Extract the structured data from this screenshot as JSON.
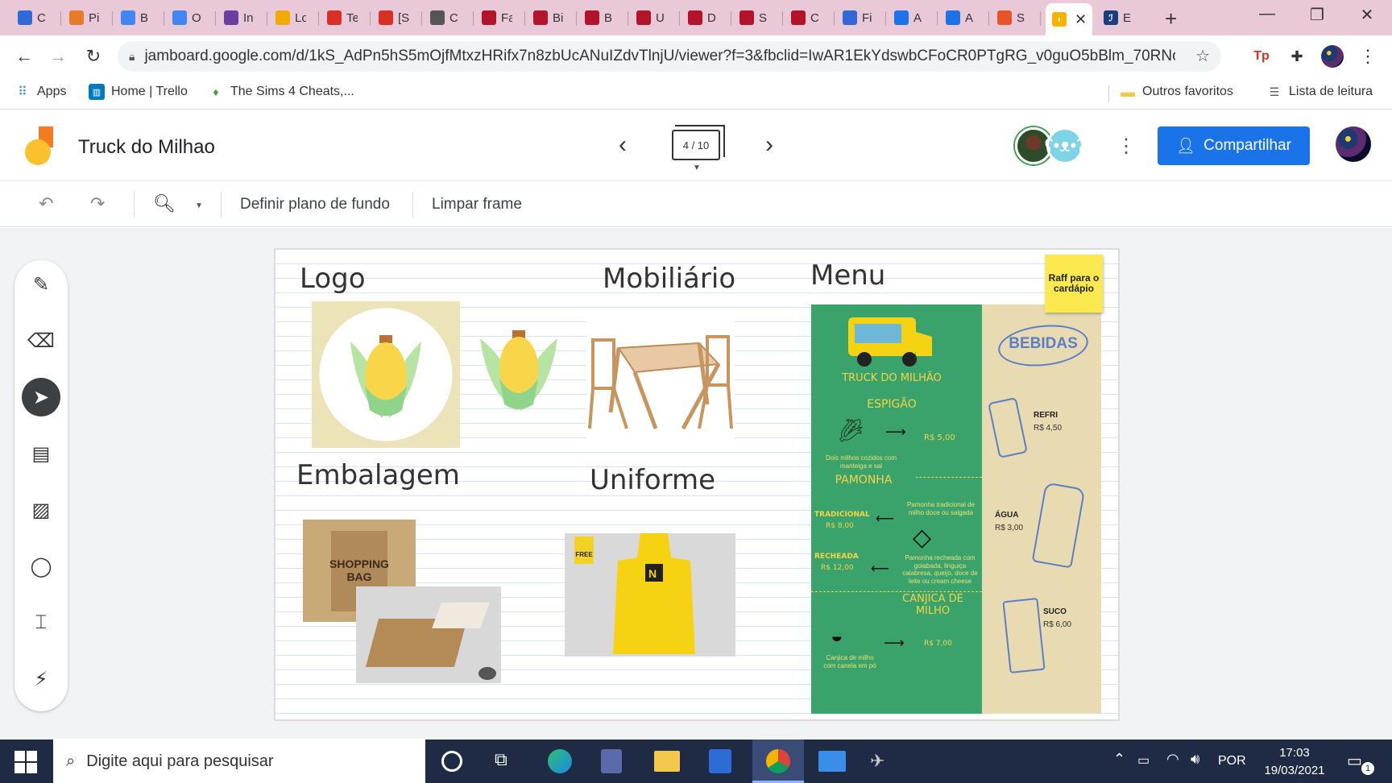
{
  "browser": {
    "tabs": [
      {
        "label": "C",
        "icon": "tab-favicon",
        "color": "#2f6bd6"
      },
      {
        "label": "Pi",
        "icon": "tab-favicon",
        "color": "#e57c2b"
      },
      {
        "label": "B",
        "icon": "google-icon",
        "color": "#4285f4"
      },
      {
        "label": "O",
        "icon": "google-icon",
        "color": "#4285f4"
      },
      {
        "label": "In",
        "icon": "tab-favicon",
        "color": "#6b3fa0"
      },
      {
        "label": "Lo",
        "icon": "tab-favicon",
        "color": "#f2a900"
      },
      {
        "label": "Te",
        "icon": "tab-favicon",
        "color": "#d93025"
      },
      {
        "label": "[S",
        "icon": "gmail-icon",
        "color": "#d93025"
      },
      {
        "label": "C",
        "icon": "wikipedia-icon",
        "color": "#555555"
      },
      {
        "label": "Fa",
        "icon": "tab-favicon",
        "color": "#b3132b"
      },
      {
        "label": "Bi",
        "icon": "tab-favicon",
        "color": "#b3132b"
      },
      {
        "label": "B",
        "icon": "tab-favicon",
        "color": "#b3132b"
      },
      {
        "label": "U",
        "icon": "tab-favicon",
        "color": "#b3132b"
      },
      {
        "label": "D",
        "icon": "tab-favicon",
        "color": "#b3132b"
      },
      {
        "label": "S",
        "icon": "tab-favicon",
        "color": "#b3132b"
      },
      {
        "label": "C",
        "icon": "tab-favicon",
        "color": "#b3132b"
      },
      {
        "label": "Fi",
        "icon": "tab-favicon",
        "color": "#3367d6"
      },
      {
        "label": "A",
        "icon": "tab-favicon",
        "color": "#1a73e8"
      },
      {
        "label": "A",
        "icon": "tab-favicon",
        "color": "#1a73e8"
      },
      {
        "label": "S",
        "icon": "tab-favicon",
        "color": "#e8542a"
      }
    ],
    "active_tab_close": "✕",
    "last_tab": {
      "label": "E",
      "color": "#1a3d7c"
    },
    "url": "jamboard.google.com/d/1kS_AdPn5hS5mOjfMtxzHRifx7n8zbUcANuIZdvTlnjU/viewer?f=3&fbclid=IwAR1EkYdswbCFoCR0PTgRG_v0guO5bBlm_70RNozBU...",
    "bookmarks": {
      "apps": "Apps",
      "trello": "Home | Trello",
      "sims": "The Sims 4 Cheats,...",
      "other": "Outros favoritos",
      "reading": "Lista de leitura"
    }
  },
  "jamboard": {
    "title": "Truck do Milhao",
    "frame_indicator": "4 / 10",
    "share_label": "Compartilhar",
    "toolbar": {
      "background_label": "Definir plano de fundo",
      "clear_label": "Limpar frame"
    },
    "frame": {
      "headings": {
        "logo": "Logo",
        "mobiliario": "Mobiliário",
        "menu": "Menu",
        "embalagem": "Embalagem",
        "uniforme": "Uniforme"
      },
      "sticky_note": "Raff para o cardápio",
      "bag_text": "SHOPPING BAG",
      "apron_tag": "FREE",
      "menu_card": {
        "truck_title": "TRUCK DO MILHÃO",
        "espigao": "ESPIGÃO",
        "espigao_price": "R$ 5,00",
        "espigao_desc": "Dois milhos cozidos com manteiga e sal",
        "pamonha": "PAMONHA",
        "tradicional": "TRADICIONAL",
        "tradicional_price": "R$ 8,00",
        "tradicional_desc": "Pamonha tradicional de milho doce ou salgada",
        "recheada": "RECHEADA",
        "recheada_price": "R$ 12,00",
        "recheada_desc": "Pamonha recheada com goiabada, linguiça calabresa, queijo, doce de leite ou cream cheese",
        "canjica": "CANJICA DE MILHO",
        "canjica_price": "R$ 7,00",
        "canjica_desc": "Canjica de milho com canela em pó",
        "bebidas": "BEBIDAS",
        "refri": "REFRI",
        "refri_price": "R$ 4,50",
        "agua": "ÁGUA",
        "agua_price": "R$ 3,00",
        "suco": "SUCO",
        "suco_price": "R$ 6,00"
      }
    }
  },
  "taskbar": {
    "search_placeholder": "Digite aqui para pesquisar",
    "language": "POR",
    "time": "17:03",
    "date": "19/03/2021",
    "notification_count": "1"
  },
  "colors": {
    "tab_strip": "#e9c9d8",
    "share_button": "#1a73e8",
    "taskbar": "#1f2b44",
    "menu_green": "#3aa26b",
    "menu_beige": "#e8dbb2",
    "sticky_note": "#fce94f"
  }
}
